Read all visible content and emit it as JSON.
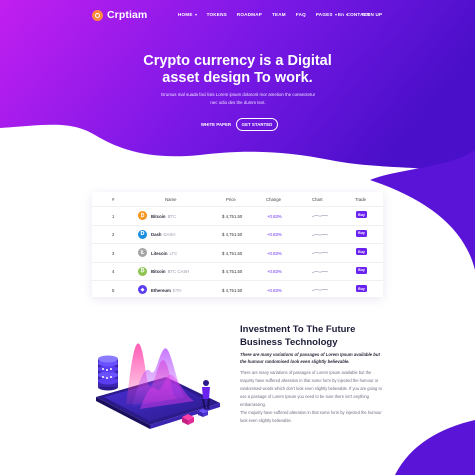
{
  "colors": {
    "brand_purple": "#6a22f0",
    "hero_start": "#c21ff0",
    "hero_end": "#4a0fc9",
    "accent_orange": "#ff8a3d"
  },
  "nav": {
    "logo_text": "Crptiam",
    "items": [
      {
        "label": "HOME",
        "has_dropdown": true
      },
      {
        "label": "TOKENS",
        "has_dropdown": false
      },
      {
        "label": "ROADMAP",
        "has_dropdown": false
      },
      {
        "label": "TEAM",
        "has_dropdown": false
      },
      {
        "label": "FAQ",
        "has_dropdown": false
      },
      {
        "label": "PAGES",
        "has_dropdown": true
      },
      {
        "label": "CONTACT",
        "has_dropdown": false
      }
    ],
    "language": "En",
    "signup": "SIGN UP"
  },
  "hero": {
    "title_line1": "Crypto currency is a Digital",
    "title_line2": "asset design To work.",
    "subtitle": "Grursus mal suada faci lisis Lorem ipsum dolarorit mor ametion the consectetur nec odio des the dumm text.",
    "white_paper_label": "WHITE PAPER",
    "get_started_label": "GET STARTED"
  },
  "table": {
    "headers": {
      "num": "#",
      "name": "Name",
      "price": "Price",
      "change": "Change",
      "chart": "Chart",
      "trade": "Trade"
    },
    "rows": [
      {
        "num": "1",
        "name": "Bitcoin",
        "ticker": "BTC",
        "price": "$ 4,751.50",
        "change": "+0.83%",
        "trade": "Buy",
        "icon": "bitcoin-icon",
        "color": "#f7931a",
        "glyph": "₿"
      },
      {
        "num": "2",
        "name": "Dash",
        "ticker": "DASH",
        "price": "$ 4,751.50",
        "change": "+0.83%",
        "trade": "Buy",
        "icon": "dash-icon",
        "color": "#1c8de0",
        "glyph": "D"
      },
      {
        "num": "3",
        "name": "Litecoin",
        "ticker": "LTC",
        "price": "$ 4,751.50",
        "change": "+0.83%",
        "trade": "Buy",
        "icon": "litecoin-icon",
        "color": "#a5a5a5",
        "glyph": "Ł"
      },
      {
        "num": "4",
        "name": "Bitcoin",
        "ticker": "BTC CASH",
        "price": "$ 4,751.50",
        "change": "+0.83%",
        "trade": "Buy",
        "icon": "bitcoin-cash-icon",
        "color": "#8dc351",
        "glyph": "₿"
      },
      {
        "num": "5",
        "name": "Ethereum",
        "ticker": "ETH",
        "price": "$ 4,751.50",
        "change": "+0.83%",
        "trade": "Buy",
        "icon": "ethereum-icon",
        "color": "#5b3df0",
        "glyph": "◆"
      }
    ]
  },
  "invest": {
    "title": "Investment To The Future Business Technology",
    "lead": "There are many variations of passages of Lorem Ipsum available but the humour randomised look even slightly believable.",
    "para1": "There are many variations of passages of Lorem Ipsum available but the majority have suffered alteration in that some form by injected the humour or randomised words which don't look even slightly believable. If you are going to use a passage of Lorem Ipsum you need to be sure there isn't anything embarrassing.",
    "para2": "The majority have suffered alteration in that some form by injected the humour look even slightly believable."
  }
}
